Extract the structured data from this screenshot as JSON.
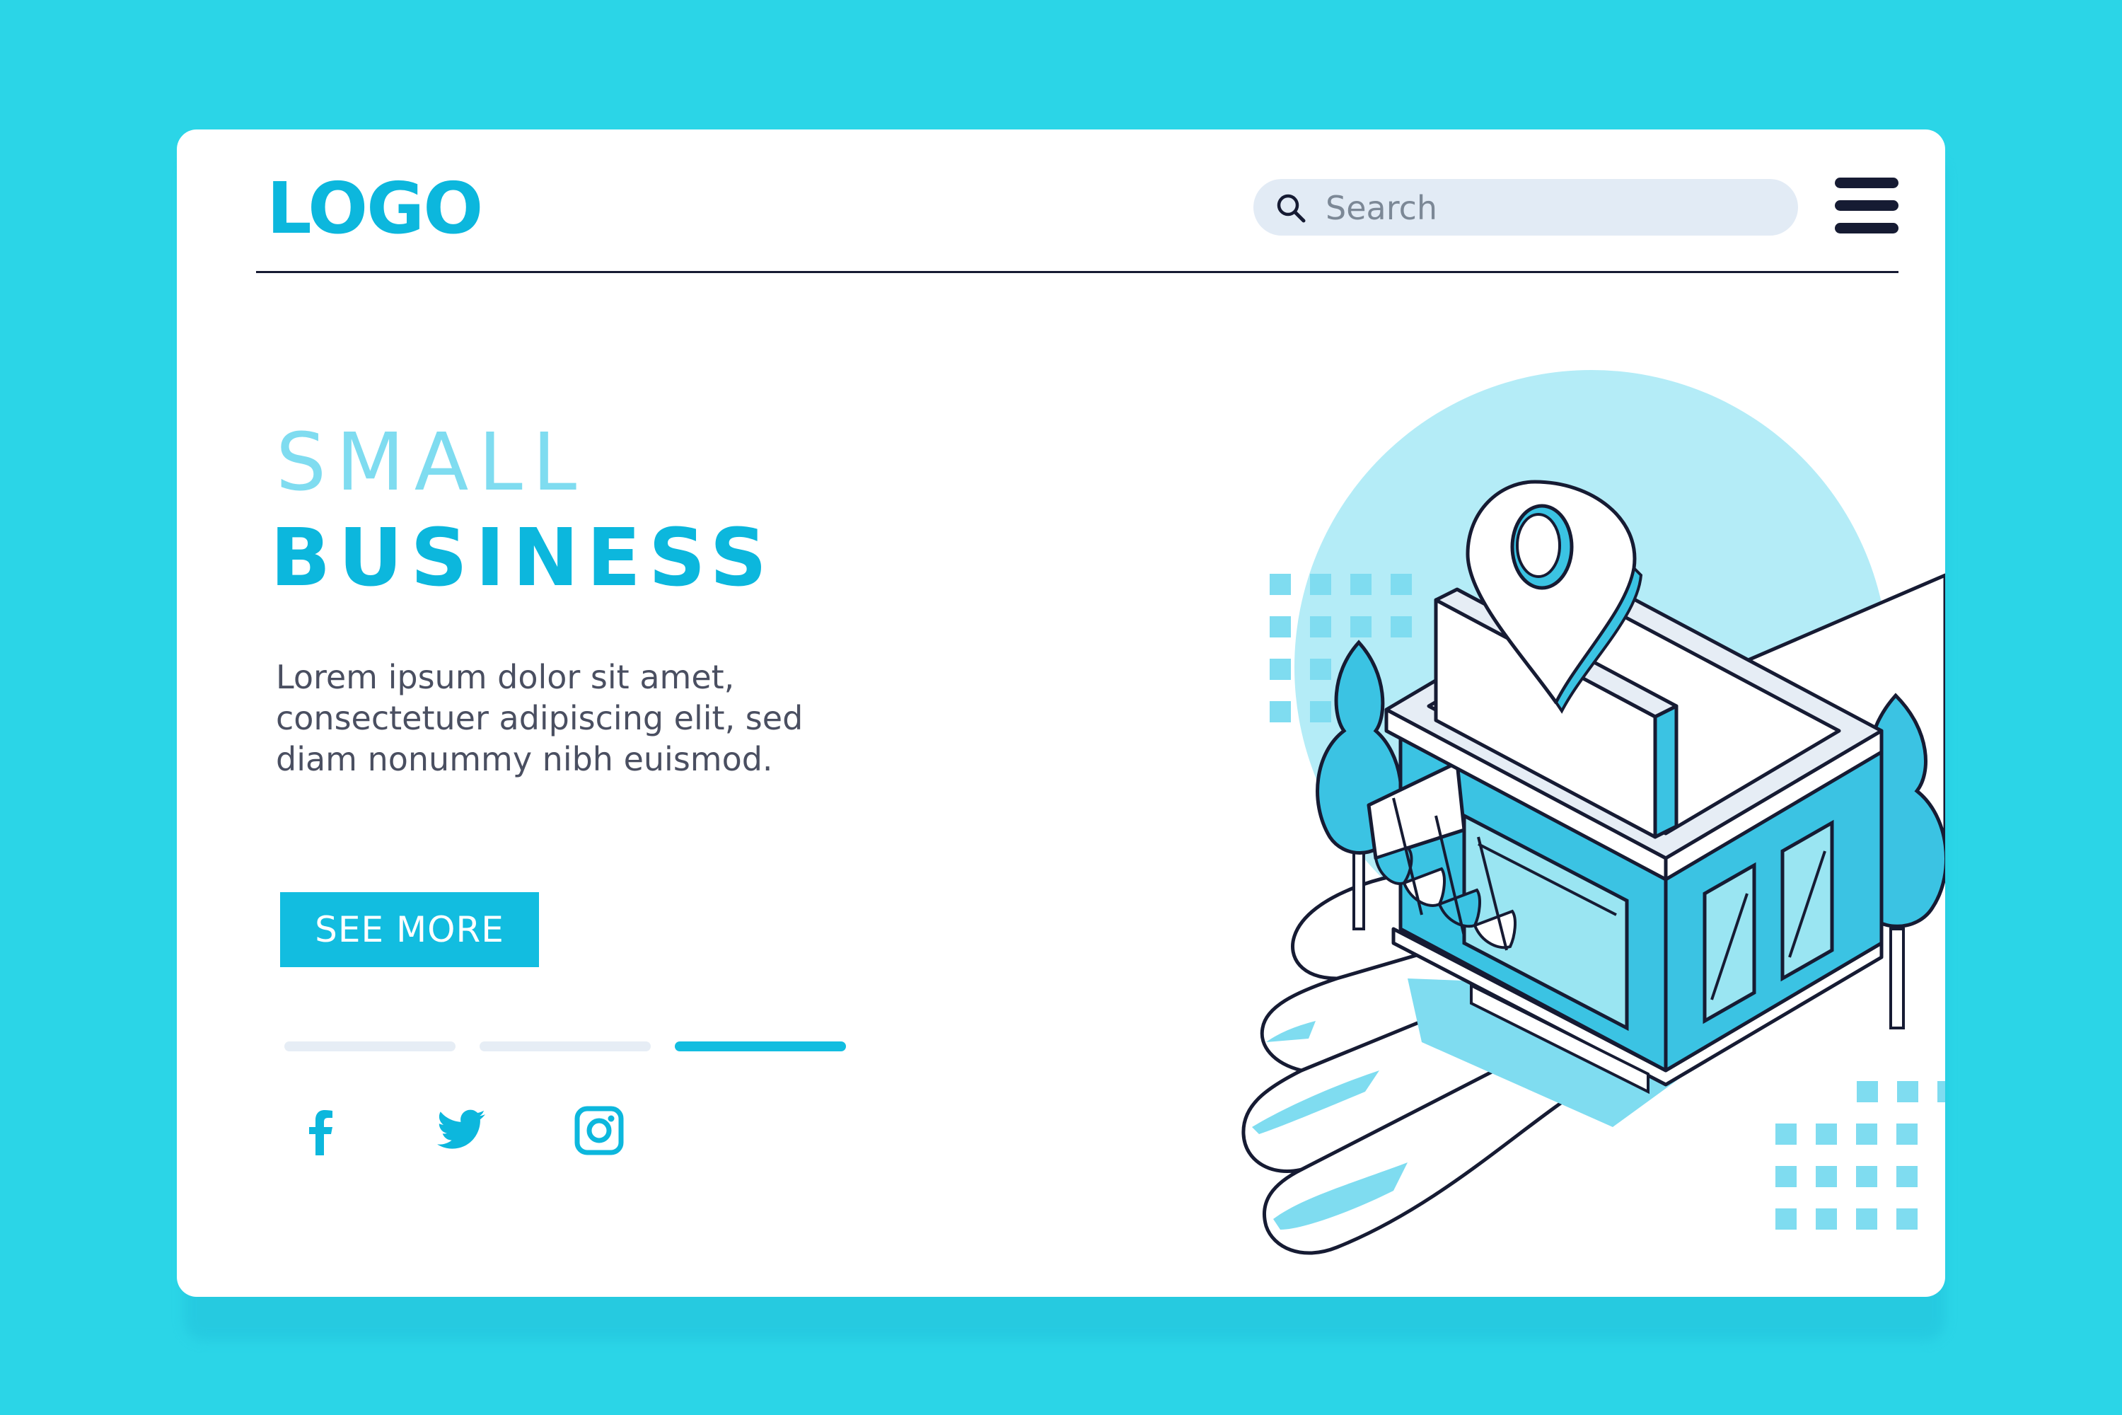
{
  "header": {
    "logo_text": "LOGO",
    "search": {
      "placeholder": "Search",
      "value": ""
    },
    "menu_icon": "hamburger-menu-icon"
  },
  "hero": {
    "title_line1": "SMALL",
    "title_line2": "BUSINESS",
    "description": "Lorem ipsum dolor sit amet, consectetuer adipiscing elit, sed diam nonummy nibh euismod.",
    "cta_label": "SEE MORE"
  },
  "pagination": {
    "total": 3,
    "active_index": 3
  },
  "social": [
    {
      "icon": "facebook-icon"
    },
    {
      "icon": "twitter-icon"
    },
    {
      "icon": "instagram-icon"
    }
  ],
  "illustration": {
    "subject": "isometric storefront with location pin on an open hand"
  },
  "colors": {
    "background": "#2bd5e7",
    "card": "#ffffff",
    "accent": "#0cb7dd",
    "accent_light": "#7fdcf0",
    "ink": "#161b33",
    "body_text": "#4a4f61",
    "search_bg": "#e2ebf5"
  }
}
